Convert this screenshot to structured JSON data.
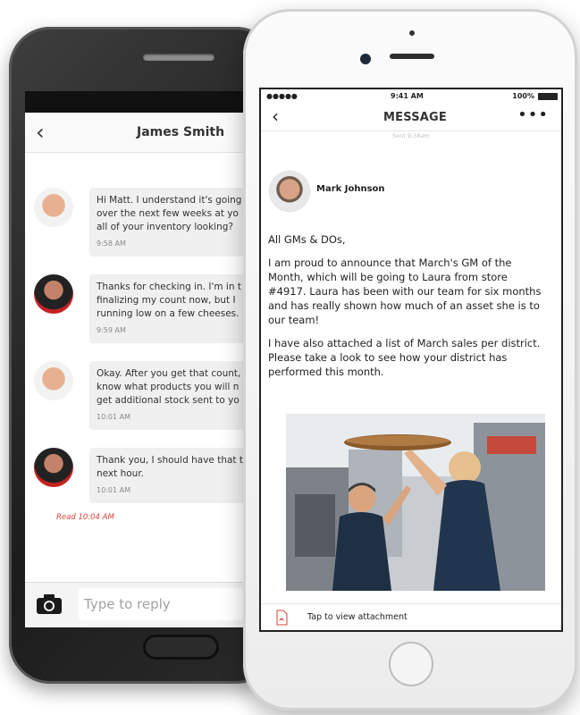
{
  "android_app": {
    "header": {
      "back_glyph": "‹",
      "title": "James Smith"
    },
    "messages": [
      {
        "sender": "light",
        "lines": [
          "Hi Matt. I understand it's going",
          "over the next few weeks at yo",
          "all of your inventory looking?"
        ],
        "time": "9:58 AM"
      },
      {
        "sender": "dark",
        "lines": [
          "Thanks for checking in. I'm in t",
          "finalizing my count now, but I",
          "running low on a few cheeses."
        ],
        "time": "9:59 AM"
      },
      {
        "sender": "light",
        "lines": [
          "Okay. After you get that count,",
          "know what products you will n",
          "get additional stock sent to yo"
        ],
        "time": "10:01 AM"
      },
      {
        "sender": "dark",
        "lines": [
          "Thank you, I should have that t",
          "next hour."
        ],
        "time": "10:01 AM"
      }
    ],
    "read_receipt": "Read 10:04 AM",
    "reply_placeholder": "Type to reply"
  },
  "iphone_app": {
    "status": {
      "carrier": "●●●●● ",
      "time": "9:41 AM",
      "battery": "100%"
    },
    "header": {
      "back_glyph": "‹",
      "title": "MESSAGE",
      "more_glyph": "•••"
    },
    "sent_label": "Sent 9:38am",
    "sender_name": "Mark Johnson",
    "body": {
      "greeting": "All GMs & DOs,",
      "paragraph1": [
        "I am proud to announce that March's GM of the",
        "Month, which will be going to Laura from store",
        "#4917. Laura has been with our team for six months",
        "and has really shown how much of an asset she is to",
        "our team!"
      ],
      "paragraph2": [
        "I have also attached a list of March sales per district.",
        "Please take a look to see how your district has",
        "performed this month."
      ]
    },
    "attachment_label": "Tap to view attachment"
  },
  "colors": {
    "accent_red": "#d8433a",
    "bubble_gray": "#f0f0f0",
    "android_body": "#1c1c1c",
    "iphone_body": "#f2f2f2"
  }
}
